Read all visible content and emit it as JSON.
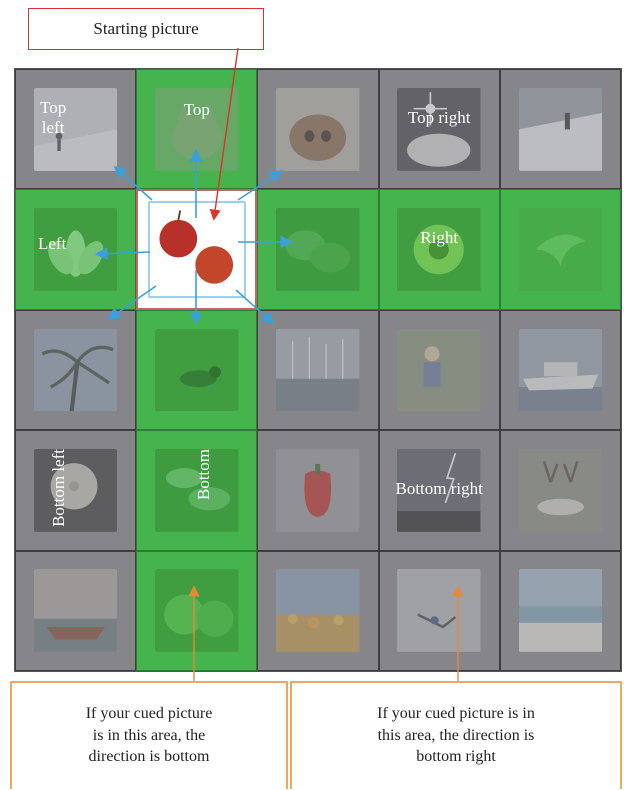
{
  "starting_label": "Starting picture",
  "cells": [
    [
      {
        "color": "gray",
        "subject": "skier",
        "label": "Top\nleft"
      },
      {
        "color": "green",
        "subject": "cat",
        "label": "Top"
      },
      {
        "color": "gray",
        "subject": "cow",
        "label": ""
      },
      {
        "color": "gray",
        "subject": "sparkle",
        "label": "Top right"
      },
      {
        "color": "gray",
        "subject": "snow-slope",
        "label": ""
      }
    ],
    [
      {
        "color": "green",
        "subject": "lotus",
        "label": "Left"
      },
      {
        "color": "start",
        "subject": "onions",
        "label": ""
      },
      {
        "color": "green",
        "subject": "leaves",
        "label": ""
      },
      {
        "color": "green",
        "subject": "sunflower",
        "label": "Right"
      },
      {
        "color": "green",
        "subject": "bird",
        "label": ""
      }
    ],
    [
      {
        "color": "gray",
        "subject": "palm",
        "label": ""
      },
      {
        "color": "green",
        "subject": "duck",
        "label": ""
      },
      {
        "color": "gray",
        "subject": "harbor",
        "label": ""
      },
      {
        "color": "gray",
        "subject": "child",
        "label": ""
      },
      {
        "color": "gray",
        "subject": "ship",
        "label": ""
      }
    ],
    [
      {
        "color": "gray",
        "subject": "dandelion",
        "label": "Bottom left"
      },
      {
        "color": "green",
        "subject": "clouds",
        "label": "Bottom"
      },
      {
        "color": "gray",
        "subject": "pepper",
        "label": ""
      },
      {
        "color": "gray",
        "subject": "lightning",
        "label": "Bottom right"
      },
      {
        "color": "gray",
        "subject": "deer",
        "label": ""
      }
    ],
    [
      {
        "color": "gray",
        "subject": "boat",
        "label": ""
      },
      {
        "color": "green",
        "subject": "tomatoes",
        "label": ""
      },
      {
        "color": "gray",
        "subject": "flowers",
        "label": ""
      },
      {
        "color": "gray",
        "subject": "paraglider",
        "label": ""
      },
      {
        "color": "gray",
        "subject": "beach",
        "label": ""
      }
    ]
  ],
  "bottom_note_left": "If your cued picture\nis in this area, the\ndirection is bottom",
  "bottom_note_right": "If your cued picture is in\nthis area, the direction is\nbottom right",
  "colors": {
    "gray": "#86868a",
    "green": "#46b44d",
    "arrow_blue": "#3aa0d8",
    "arrow_red": "#d9342b",
    "arrow_orange": "#e8883a"
  }
}
